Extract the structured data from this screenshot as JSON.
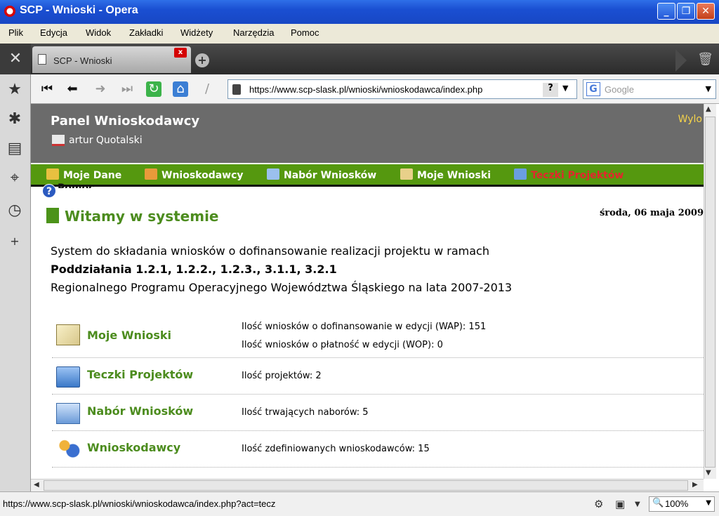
{
  "window": {
    "title": "SCP - Wnioski - Opera",
    "minimize": "_",
    "maximize": "❐",
    "close": "✕"
  },
  "menu": [
    "Plik",
    "Edycja",
    "Widok",
    "Zakładki",
    "Widżety",
    "Narzędzia",
    "Pomoc"
  ],
  "tab": {
    "title": "SCP - Wnioski",
    "close": "x",
    "new": "+"
  },
  "panel": {
    "tools": "✕",
    "bookmarks": "★",
    "settings": "✱",
    "notes": "▤",
    "transfers": "⌖",
    "history": "◷",
    "add": "+"
  },
  "nav": {
    "url": "https://www.scp-slask.pl/wnioski/wnioskodawca/index.php",
    "search_placeholder": "Google",
    "help": "?",
    "search_engine": "G"
  },
  "page": {
    "header_title": "Panel Wnioskodawcy",
    "user": "artur Quotalski",
    "logout": "Wylo",
    "menu": [
      {
        "label": "Moje Dane",
        "color": "#e8c040"
      },
      {
        "label": "Wnioskodawcy",
        "color": "#e89a3a"
      },
      {
        "label": "Nabór Wniosków",
        "color": "#9bc0ee"
      },
      {
        "label": "Moje Wnioski",
        "color": "#e8d08a"
      },
      {
        "label": "Teczki Projektów",
        "color": "#6a9ee0"
      }
    ],
    "help_label": "Pomoc",
    "welcome": "Witamy w systemie",
    "date": "środa, 06 maja 2009",
    "intro": [
      "System do składania wniosków o dofinansowanie realizacji projektu w ramach",
      "Poddziałania 1.2.1, 1.2.2., 1.2.3., 3.1.1, 3.2.1",
      "Regionalnego Programu Operacyjnego Województwa Śląskiego na lata 2007-2013"
    ],
    "rows": [
      {
        "label": "Moje Wnioski",
        "info": [
          "Ilość wniosków o dofinansowanie w edycji (WAP): 151",
          "Ilość wniosków o płatność w edycji (WOP): 0"
        ]
      },
      {
        "label": "Teczki Projektów",
        "info": [
          "Ilość projektów: 2"
        ]
      },
      {
        "label": "Nabór Wniosków",
        "info": [
          "Ilość trwających naborów: 5"
        ]
      },
      {
        "label": "Wnioskodawcy",
        "info": [
          "Ilość zdefiniowanych wnioskodawców: 15"
        ]
      }
    ]
  },
  "status": {
    "url": "https://www.scp-slask.pl/wnioski/wnioskodawca/index.php?act=tecz",
    "zoom": "100%"
  }
}
